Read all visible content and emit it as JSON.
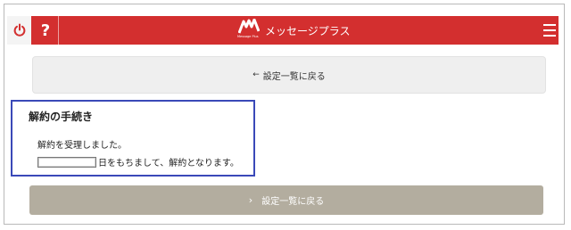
{
  "header": {
    "brand_title": "メッセージプラス",
    "logo_subtext": "Message Plus",
    "help_label": "?",
    "accent_color": "#d32f2f"
  },
  "icons": {
    "power": "power-icon",
    "help": "question-icon",
    "menu": "hamburger-menu-icon",
    "back_arrow": "arrow-left-icon",
    "chevron": "chevron-right-icon"
  },
  "top_button": {
    "arrow": "←",
    "label": "設定一覧に戻る"
  },
  "notice": {
    "title": "解約の手続き",
    "line1": "解約を受理しました。",
    "line2_suffix": "日をもちまして、解約となります。",
    "border_color": "#3a49b8"
  },
  "bottom_button": {
    "chevron": "›",
    "label": "設定一覧に戻る",
    "color": "#b3ad9f"
  }
}
